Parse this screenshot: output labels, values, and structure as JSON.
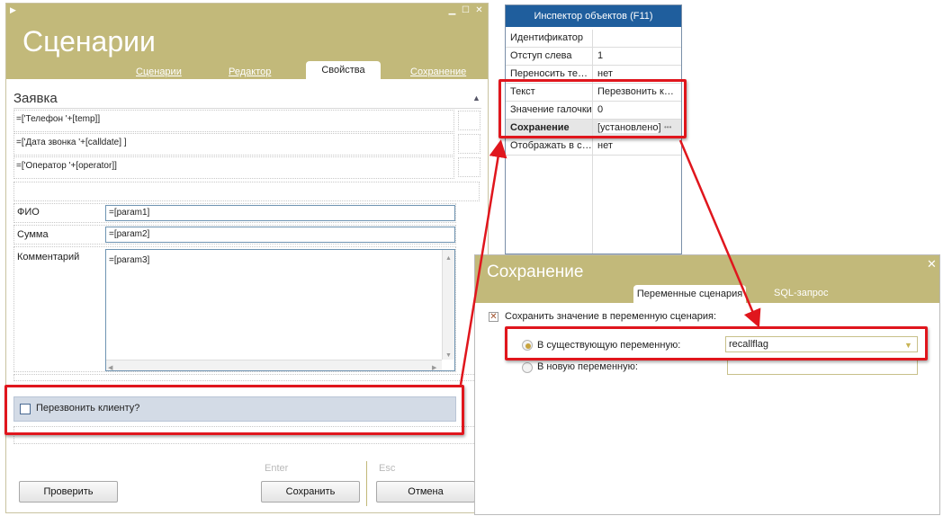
{
  "main": {
    "title": "Сценарии",
    "tabs": [
      "Сценарии",
      "Редактор",
      "Свойства",
      "Сохранение"
    ],
    "section_title": "Заявка",
    "expressions": [
      "=['Телефон '+[temp]]",
      "=['Дата звонка '+[calldate] ]",
      "=['Оператор '+[operator]]"
    ],
    "fields": [
      {
        "label": "ФИО",
        "value": "=[param1]"
      },
      {
        "label": "Сумма",
        "value": "=[param2]"
      },
      {
        "label": "Комментарий",
        "value": "=[param3]"
      }
    ],
    "checkbox_label": "Перезвонить клиенту?",
    "hints": {
      "enter": "Enter",
      "esc": "Esc"
    },
    "buttons": {
      "check": "Проверить",
      "save": "Сохранить",
      "cancel": "Отмена"
    }
  },
  "inspector": {
    "title": "Инспектор объектов (F11)",
    "rows": [
      {
        "name": "Идентификатор",
        "value": ""
      },
      {
        "name": "Отступ слева",
        "value": "1"
      },
      {
        "name": "Переносить текст",
        "value": "нет"
      },
      {
        "name": "Текст",
        "value": "Перезвонить клиенту?"
      },
      {
        "name": "Значение галочки",
        "value": "0"
      },
      {
        "name": "Сохранение",
        "value": "[установлено]"
      },
      {
        "name": "Отображать в сообщении",
        "value": "нет"
      }
    ],
    "ellipsis": "•••"
  },
  "dialog": {
    "title": "Сохранение",
    "close": "✕",
    "tabs": [
      "Переменные сценария",
      "SQL-запрос"
    ],
    "save_checkbox_label": "Сохранить значение в переменную сценария:",
    "option_existing": "В существующую переменную:",
    "option_new": "В новую переменную:",
    "existing_value": "recallflag"
  },
  "colors": {
    "header": "#c2b97a",
    "inspector_title": "#1f5e9d",
    "callout": "#e0161d",
    "checkbox_row": "#d3dbe6"
  }
}
